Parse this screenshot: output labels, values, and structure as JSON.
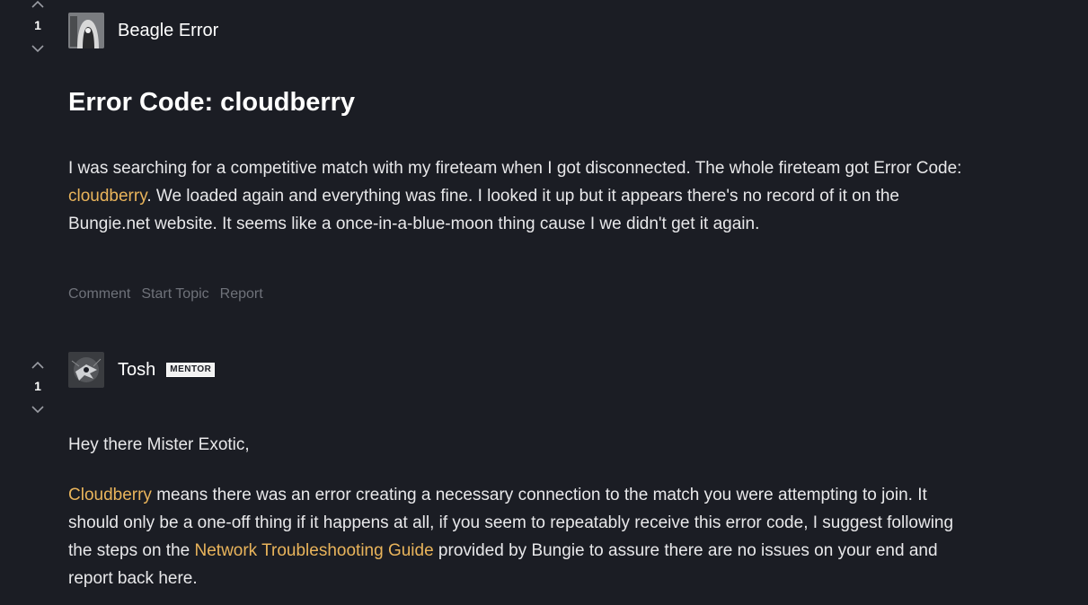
{
  "post1": {
    "vote_count": "1",
    "author": "Beagle Error",
    "title": "Error Code: cloudberry",
    "body": {
      "seg1": "I was searching for a competitive match with my fireteam when I got disconnected. The whole fireteam got Error Code: ",
      "link": "cloudberry",
      "seg2": ". We loaded again and everything was fine. I looked it up but it appears there's no record of it on the Bungie.net website. It seems like a once-in-a-blue-moon thing cause I we didn't get it again."
    },
    "actions": {
      "comment": "Comment",
      "start_topic": "Start Topic",
      "report": "Report"
    }
  },
  "post2": {
    "vote_count": "1",
    "author": "Tosh",
    "badge": "MENTOR",
    "greeting": "Hey there Mister Exotic,",
    "body": {
      "link1": "Cloudberry",
      "seg1": " means there was an error creating a necessary connection to the match you were attempting to join. It should only be a one-off thing if it happens at all, if you seem to repeatably receive this error code, I suggest following the steps on the ",
      "link2": "Network Troubleshooting Guide",
      "seg2": " provided by Bungie to assure there are no issues on your end and report back here."
    }
  },
  "colors": {
    "background": "#1b1d24",
    "link": "#e9b45b",
    "muted": "#6f727a"
  },
  "icons": [
    "chevron-up-icon",
    "chevron-down-icon"
  ]
}
